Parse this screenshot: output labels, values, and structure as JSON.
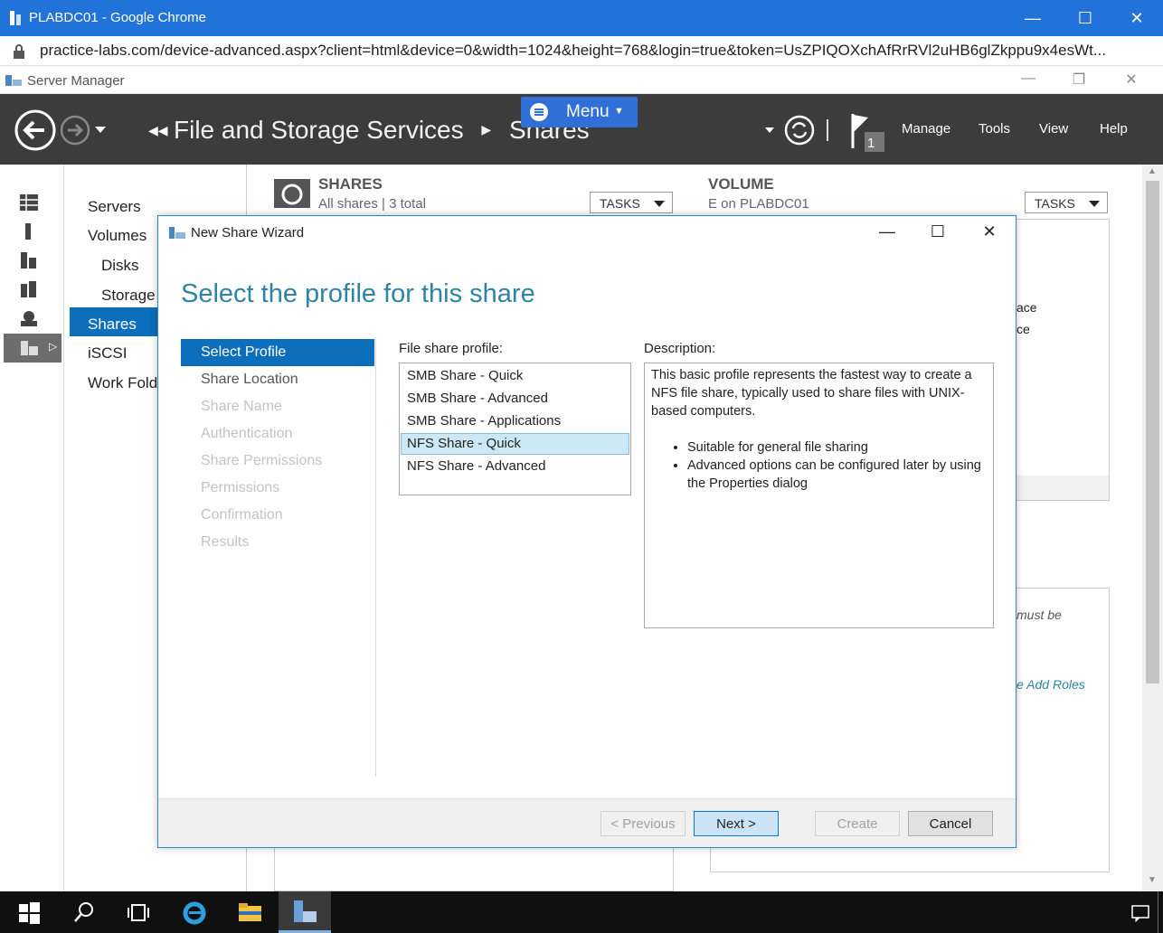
{
  "browser": {
    "window_title": "PLABDC01 - Google Chrome",
    "url": "practice-labs.com/device-advanced.aspx?client=html&device=0&width=1024&height=768&login=true&token=UsZPIQOXchAfRrRVl2uHB6glZkppu9x4esWt..."
  },
  "server_manager": {
    "title": "Server Manager",
    "breadcrumb": "File and Storage Services",
    "breadcrumb_current": "Shares",
    "menu_label": "Menu",
    "notification_count": "1",
    "nav_buttons": [
      "Manage",
      "Tools",
      "View",
      "Help"
    ],
    "nav_items": [
      {
        "label": "Servers",
        "sub": false
      },
      {
        "label": "Volumes",
        "sub": false
      },
      {
        "label": "Disks",
        "sub": true
      },
      {
        "label": "Storage",
        "sub": true
      },
      {
        "label": "Shares",
        "sub": false,
        "selected": true
      },
      {
        "label": "iSCSI",
        "sub": false
      },
      {
        "label": "Work Fold",
        "sub": false
      }
    ],
    "shares": {
      "title": "SHARES",
      "subtitle": "All shares | 3 total",
      "tasks": "TASKS"
    },
    "volume": {
      "title": "VOLUME",
      "subtitle": "E on PLABDC01",
      "tasks": "TASKS"
    },
    "background_fragments": [
      "ace",
      "ce",
      "must be",
      "e Add Roles"
    ]
  },
  "wizard": {
    "title": "New Share Wizard",
    "heading": "Select the profile for this share",
    "steps": [
      {
        "label": "Select Profile",
        "state": "active"
      },
      {
        "label": "Share Location",
        "state": "enabled"
      },
      {
        "label": "Share Name",
        "state": "disabled"
      },
      {
        "label": "Authentication",
        "state": "disabled"
      },
      {
        "label": "Share Permissions",
        "state": "disabled"
      },
      {
        "label": "Permissions",
        "state": "disabled"
      },
      {
        "label": "Confirmation",
        "state": "disabled"
      },
      {
        "label": "Results",
        "state": "disabled"
      }
    ],
    "profile_label": "File share profile:",
    "profiles": [
      {
        "label": "SMB Share - Quick",
        "selected": false
      },
      {
        "label": "SMB Share - Advanced",
        "selected": false
      },
      {
        "label": "SMB Share - Applications",
        "selected": false
      },
      {
        "label": "NFS Share - Quick",
        "selected": true
      },
      {
        "label": "NFS Share - Advanced",
        "selected": false
      }
    ],
    "description_label": "Description:",
    "description_text": "This basic profile represents the fastest way to create a NFS file share, typically used to share files with UNIX-based computers.",
    "description_bullets": [
      "Suitable for general file sharing",
      "Advanced options can be configured later by using the Properties dialog"
    ],
    "buttons": {
      "previous": "< Previous",
      "next": "Next >",
      "create": "Create",
      "cancel": "Cancel"
    }
  }
}
